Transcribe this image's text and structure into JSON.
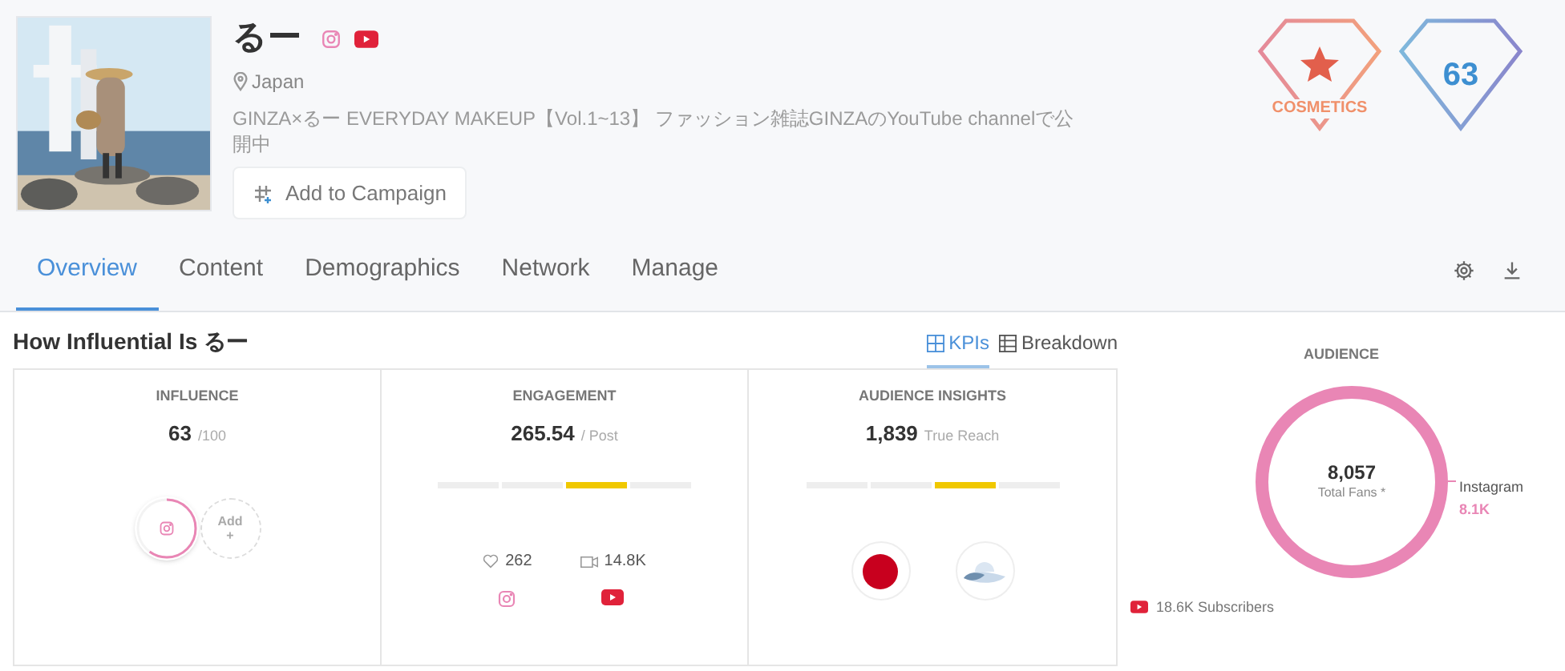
{
  "profile": {
    "name": "るー",
    "location": "Japan",
    "bio": "GINZA×るー EVERYDAY MAKEUP【Vol.1~13】 ファッション雑誌GINZAのYouTube channelで公開中",
    "add_button": "Add to Campaign"
  },
  "badges": [
    {
      "kind": "category",
      "label": "COSMETICS"
    },
    {
      "kind": "score",
      "label": "63"
    }
  ],
  "tabs": [
    {
      "label": "Overview",
      "selected": true
    },
    {
      "label": "Content",
      "selected": false
    },
    {
      "label": "Demographics",
      "selected": false
    },
    {
      "label": "Network",
      "selected": false
    },
    {
      "label": "Manage",
      "selected": false
    }
  ],
  "section": {
    "title": "How Influential Is るー",
    "views": [
      {
        "label": "KPIs",
        "selected": true,
        "kind": "grid"
      },
      {
        "label": "Breakdown",
        "selected": false,
        "kind": "table"
      }
    ]
  },
  "influence": {
    "title": "INFLUENCE",
    "value": "63",
    "unit": "/100",
    "level": 0.6,
    "add_label": "Add",
    "add_plus": "+"
  },
  "engagement": {
    "title": "ENGAGEMENT",
    "value": "265.54",
    "unit": "/ Post",
    "segments": [
      {
        "selected": false
      },
      {
        "selected": false
      },
      {
        "selected": true
      },
      {
        "selected": false
      }
    ],
    "stats": [
      {
        "kind": "likes",
        "value": "262",
        "platform": {
          "kind": "instagram"
        }
      },
      {
        "kind": "views",
        "value": "14.8K",
        "platform": {
          "kind": "youtube"
        }
      }
    ]
  },
  "audience_insights": {
    "title": "AUDIENCE INSIGHTS",
    "value": "1,839",
    "unit": "True Reach",
    "segments": [
      {
        "selected": false
      },
      {
        "selected": false
      },
      {
        "selected": true
      },
      {
        "selected": false
      }
    ]
  },
  "audience": {
    "title": "AUDIENCE",
    "total": "8,057",
    "total_label": "Total Fans *",
    "platform_label": "Instagram",
    "platform_value": "8.1K",
    "subscribers": "18.6K Subscribers"
  }
}
